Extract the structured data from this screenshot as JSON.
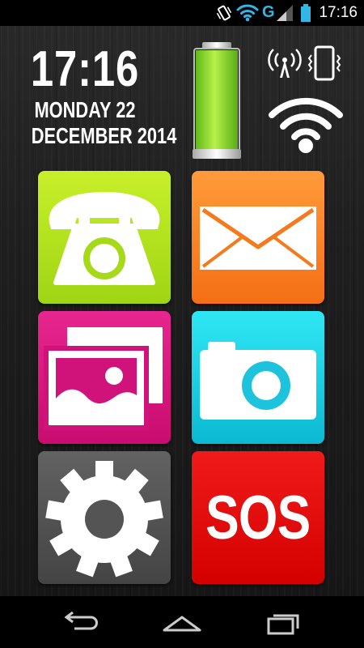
{
  "status_bar": {
    "time": "17:16",
    "network_type": "G",
    "icons": [
      "vibrate-icon",
      "wifi-icon",
      "cell-signal-icon",
      "battery-icon"
    ],
    "accent": "#33b5e5"
  },
  "clock": {
    "time": "17:16",
    "day": "MONDAY 22",
    "date": "DECEMBER 2014"
  },
  "battery": {
    "level": 1.0,
    "color": "#8ad82a"
  },
  "tiles": [
    {
      "id": "phone",
      "icon": "phone-icon",
      "color": "#b4e21f"
    },
    {
      "id": "messages",
      "icon": "envelope-icon",
      "color": "#f88427"
    },
    {
      "id": "gallery",
      "icon": "gallery-icon",
      "color": "#d8167f"
    },
    {
      "id": "camera",
      "icon": "camera-icon",
      "color": "#1fd0e3"
    },
    {
      "id": "settings",
      "icon": "gear-icon",
      "color": "#555555"
    },
    {
      "id": "sos",
      "label": "SOS",
      "color": "#e30b0b"
    }
  ],
  "nav_bar": {
    "icons": [
      "back-icon",
      "home-icon",
      "recent-apps-icon"
    ]
  }
}
